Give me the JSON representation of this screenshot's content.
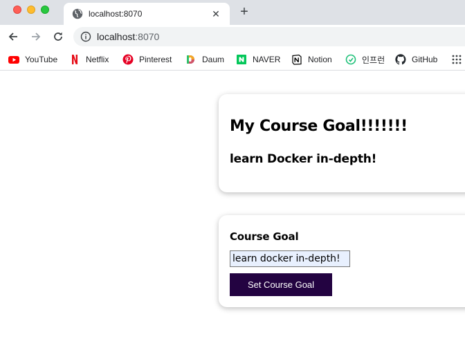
{
  "browser": {
    "tab": {
      "title": "localhost:8070",
      "favicon": "globe-icon",
      "close_icon": "close-icon"
    },
    "new_tab_icon": "plus-icon",
    "nav": {
      "back_icon": "arrow-left-icon",
      "forward_icon": "arrow-right-icon",
      "reload_icon": "reload-icon"
    },
    "address": {
      "host": "localhost",
      "port": ":8070",
      "info_icon": "info-icon"
    },
    "bookmarks": [
      {
        "label": "YouTube",
        "icon": "youtube-icon",
        "color": "#ff0000"
      },
      {
        "label": "Netflix",
        "icon": "netflix-icon",
        "color": "#e50914"
      },
      {
        "label": "Pinterest",
        "icon": "pinterest-icon",
        "color": "#e60023"
      },
      {
        "label": "Daum",
        "icon": "daum-icon",
        "color": "#4f7df6"
      },
      {
        "label": "NAVER",
        "icon": "naver-icon",
        "color": "#03c75a"
      },
      {
        "label": "Notion",
        "icon": "notion-icon",
        "color": "#000000"
      },
      {
        "label": "인프런",
        "icon": "inflearn-icon",
        "color": "#1dc078"
      },
      {
        "label": "GitHub",
        "icon": "github-icon",
        "color": "#24292e"
      }
    ],
    "apps_icon": "apps-grid-icon"
  },
  "goal_card": {
    "heading": "My Course Goal!!!!!!!",
    "goal_text": "learn Docker in-depth!"
  },
  "form": {
    "label": "Course Goal",
    "input_value": "learn docker in-depth!",
    "button_label": "Set Course Goal"
  },
  "colors": {
    "button_bg": "#230341",
    "input_bg": "#e8f0fe"
  }
}
